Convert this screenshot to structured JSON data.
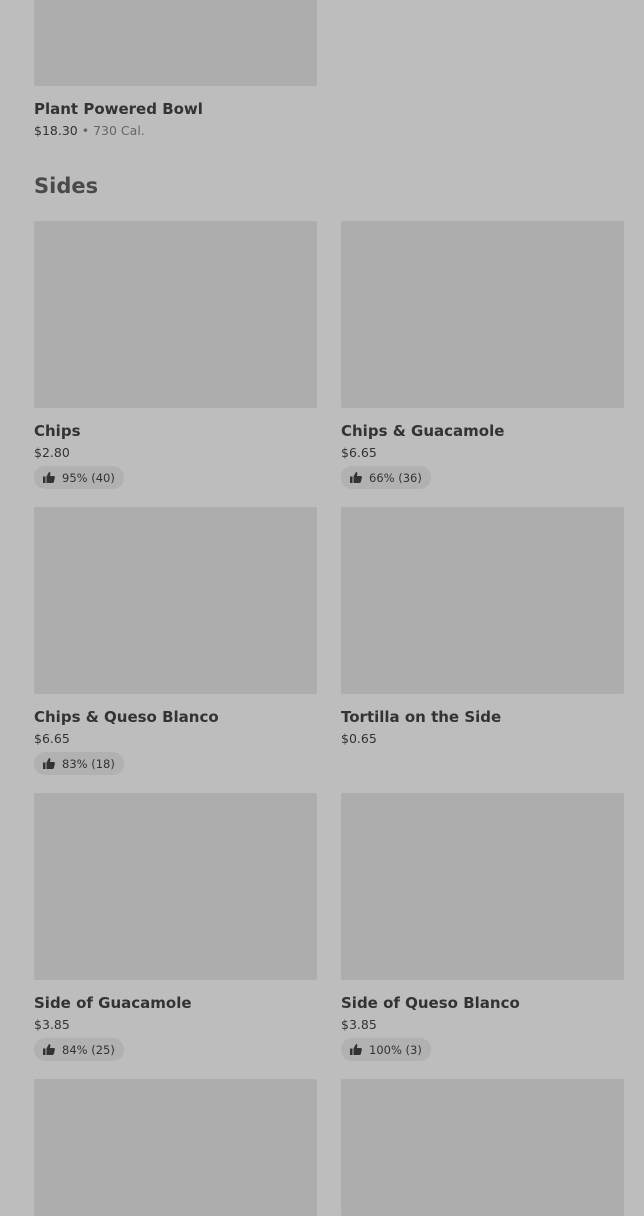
{
  "top_item": {
    "name": "Plant Powered Bowl",
    "price": "$18.30",
    "separator": "•",
    "calories": "730 Cal."
  },
  "section": {
    "title": "Sides"
  },
  "sides": [
    {
      "name": "Chips",
      "price": "$2.80",
      "rating": "95% (40)"
    },
    {
      "name": "Chips & Guacamole",
      "price": "$6.65",
      "rating": "66% (36)"
    },
    {
      "name": "Chips & Queso Blanco",
      "price": "$6.65",
      "rating": "83% (18)"
    },
    {
      "name": "Tortilla on the Side",
      "price": "$0.65"
    },
    {
      "name": "Side of Guacamole",
      "price": "$3.85",
      "rating": "84% (25)"
    },
    {
      "name": "Side of Queso Blanco",
      "price": "$3.85",
      "rating": "100% (3)"
    }
  ],
  "icons": {
    "rating": "thumbs-up-icon"
  },
  "colors": {
    "background": "#bdbdbd",
    "image_placeholder": "#adadad",
    "badge": "#b1b1b1",
    "text": "#333333"
  }
}
